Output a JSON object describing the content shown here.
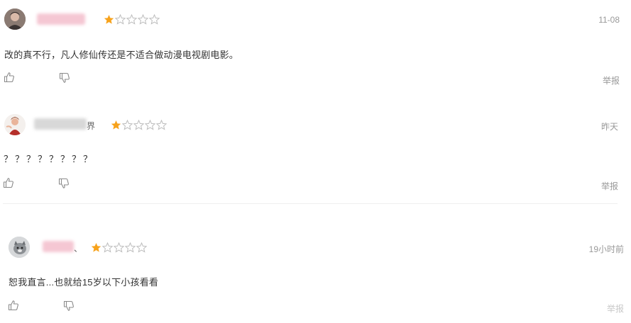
{
  "colors": {
    "star_filled": "#f7a21b",
    "star_empty": "#bdbdbd",
    "icon": "#8a8a8a"
  },
  "reviews": [
    {
      "name_suffix": "",
      "rating": 1,
      "max_rating": 5,
      "date": "11-08",
      "content": "改的真不行，凡人修仙传还是不适合做动漫电视剧电影。",
      "report_label": "举报"
    },
    {
      "name_suffix": "界",
      "rating": 1,
      "max_rating": 5,
      "date": "昨天",
      "content": "？？？？？？？？",
      "report_label": "举报"
    },
    {
      "name_suffix": "、",
      "rating": 1,
      "max_rating": 5,
      "date": "19小时前",
      "content": "恕我直言...也就给15岁以下小孩看看",
      "report_label": "举报"
    }
  ],
  "icons": {
    "like": "thumbs-up-icon",
    "dislike": "thumbs-down-icon"
  }
}
